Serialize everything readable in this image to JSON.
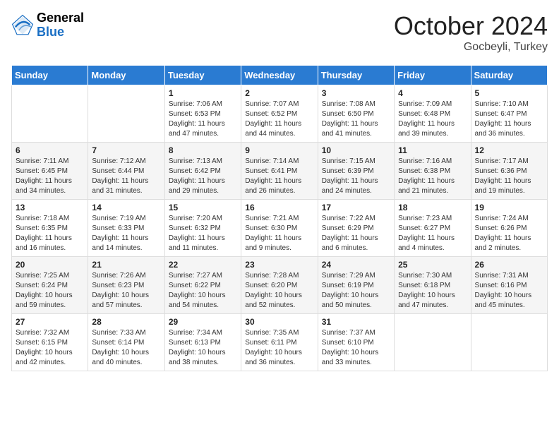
{
  "logo": {
    "general": "General",
    "blue": "Blue"
  },
  "title": {
    "month_year": "October 2024",
    "location": "Gocbeyli, Turkey"
  },
  "days_of_week": [
    "Sunday",
    "Monday",
    "Tuesday",
    "Wednesday",
    "Thursday",
    "Friday",
    "Saturday"
  ],
  "weeks": [
    [
      {
        "day": "",
        "sunrise": "",
        "sunset": "",
        "daylight": ""
      },
      {
        "day": "",
        "sunrise": "",
        "sunset": "",
        "daylight": ""
      },
      {
        "day": "1",
        "sunrise": "Sunrise: 7:06 AM",
        "sunset": "Sunset: 6:53 PM",
        "daylight": "Daylight: 11 hours and 47 minutes."
      },
      {
        "day": "2",
        "sunrise": "Sunrise: 7:07 AM",
        "sunset": "Sunset: 6:52 PM",
        "daylight": "Daylight: 11 hours and 44 minutes."
      },
      {
        "day": "3",
        "sunrise": "Sunrise: 7:08 AM",
        "sunset": "Sunset: 6:50 PM",
        "daylight": "Daylight: 11 hours and 41 minutes."
      },
      {
        "day": "4",
        "sunrise": "Sunrise: 7:09 AM",
        "sunset": "Sunset: 6:48 PM",
        "daylight": "Daylight: 11 hours and 39 minutes."
      },
      {
        "day": "5",
        "sunrise": "Sunrise: 7:10 AM",
        "sunset": "Sunset: 6:47 PM",
        "daylight": "Daylight: 11 hours and 36 minutes."
      }
    ],
    [
      {
        "day": "6",
        "sunrise": "Sunrise: 7:11 AM",
        "sunset": "Sunset: 6:45 PM",
        "daylight": "Daylight: 11 hours and 34 minutes."
      },
      {
        "day": "7",
        "sunrise": "Sunrise: 7:12 AM",
        "sunset": "Sunset: 6:44 PM",
        "daylight": "Daylight: 11 hours and 31 minutes."
      },
      {
        "day": "8",
        "sunrise": "Sunrise: 7:13 AM",
        "sunset": "Sunset: 6:42 PM",
        "daylight": "Daylight: 11 hours and 29 minutes."
      },
      {
        "day": "9",
        "sunrise": "Sunrise: 7:14 AM",
        "sunset": "Sunset: 6:41 PM",
        "daylight": "Daylight: 11 hours and 26 minutes."
      },
      {
        "day": "10",
        "sunrise": "Sunrise: 7:15 AM",
        "sunset": "Sunset: 6:39 PM",
        "daylight": "Daylight: 11 hours and 24 minutes."
      },
      {
        "day": "11",
        "sunrise": "Sunrise: 7:16 AM",
        "sunset": "Sunset: 6:38 PM",
        "daylight": "Daylight: 11 hours and 21 minutes."
      },
      {
        "day": "12",
        "sunrise": "Sunrise: 7:17 AM",
        "sunset": "Sunset: 6:36 PM",
        "daylight": "Daylight: 11 hours and 19 minutes."
      }
    ],
    [
      {
        "day": "13",
        "sunrise": "Sunrise: 7:18 AM",
        "sunset": "Sunset: 6:35 PM",
        "daylight": "Daylight: 11 hours and 16 minutes."
      },
      {
        "day": "14",
        "sunrise": "Sunrise: 7:19 AM",
        "sunset": "Sunset: 6:33 PM",
        "daylight": "Daylight: 11 hours and 14 minutes."
      },
      {
        "day": "15",
        "sunrise": "Sunrise: 7:20 AM",
        "sunset": "Sunset: 6:32 PM",
        "daylight": "Daylight: 11 hours and 11 minutes."
      },
      {
        "day": "16",
        "sunrise": "Sunrise: 7:21 AM",
        "sunset": "Sunset: 6:30 PM",
        "daylight": "Daylight: 11 hours and 9 minutes."
      },
      {
        "day": "17",
        "sunrise": "Sunrise: 7:22 AM",
        "sunset": "Sunset: 6:29 PM",
        "daylight": "Daylight: 11 hours and 6 minutes."
      },
      {
        "day": "18",
        "sunrise": "Sunrise: 7:23 AM",
        "sunset": "Sunset: 6:27 PM",
        "daylight": "Daylight: 11 hours and 4 minutes."
      },
      {
        "day": "19",
        "sunrise": "Sunrise: 7:24 AM",
        "sunset": "Sunset: 6:26 PM",
        "daylight": "Daylight: 11 hours and 2 minutes."
      }
    ],
    [
      {
        "day": "20",
        "sunrise": "Sunrise: 7:25 AM",
        "sunset": "Sunset: 6:24 PM",
        "daylight": "Daylight: 10 hours and 59 minutes."
      },
      {
        "day": "21",
        "sunrise": "Sunrise: 7:26 AM",
        "sunset": "Sunset: 6:23 PM",
        "daylight": "Daylight: 10 hours and 57 minutes."
      },
      {
        "day": "22",
        "sunrise": "Sunrise: 7:27 AM",
        "sunset": "Sunset: 6:22 PM",
        "daylight": "Daylight: 10 hours and 54 minutes."
      },
      {
        "day": "23",
        "sunrise": "Sunrise: 7:28 AM",
        "sunset": "Sunset: 6:20 PM",
        "daylight": "Daylight: 10 hours and 52 minutes."
      },
      {
        "day": "24",
        "sunrise": "Sunrise: 7:29 AM",
        "sunset": "Sunset: 6:19 PM",
        "daylight": "Daylight: 10 hours and 50 minutes."
      },
      {
        "day": "25",
        "sunrise": "Sunrise: 7:30 AM",
        "sunset": "Sunset: 6:18 PM",
        "daylight": "Daylight: 10 hours and 47 minutes."
      },
      {
        "day": "26",
        "sunrise": "Sunrise: 7:31 AM",
        "sunset": "Sunset: 6:16 PM",
        "daylight": "Daylight: 10 hours and 45 minutes."
      }
    ],
    [
      {
        "day": "27",
        "sunrise": "Sunrise: 7:32 AM",
        "sunset": "Sunset: 6:15 PM",
        "daylight": "Daylight: 10 hours and 42 minutes."
      },
      {
        "day": "28",
        "sunrise": "Sunrise: 7:33 AM",
        "sunset": "Sunset: 6:14 PM",
        "daylight": "Daylight: 10 hours and 40 minutes."
      },
      {
        "day": "29",
        "sunrise": "Sunrise: 7:34 AM",
        "sunset": "Sunset: 6:13 PM",
        "daylight": "Daylight: 10 hours and 38 minutes."
      },
      {
        "day": "30",
        "sunrise": "Sunrise: 7:35 AM",
        "sunset": "Sunset: 6:11 PM",
        "daylight": "Daylight: 10 hours and 36 minutes."
      },
      {
        "day": "31",
        "sunrise": "Sunrise: 7:37 AM",
        "sunset": "Sunset: 6:10 PM",
        "daylight": "Daylight: 10 hours and 33 minutes."
      },
      {
        "day": "",
        "sunrise": "",
        "sunset": "",
        "daylight": ""
      },
      {
        "day": "",
        "sunrise": "",
        "sunset": "",
        "daylight": ""
      }
    ]
  ]
}
